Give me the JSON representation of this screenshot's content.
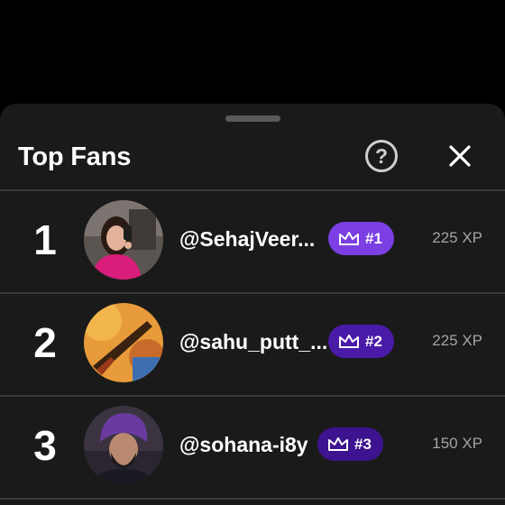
{
  "sheet": {
    "title": "Top Fans",
    "help_icon": "question-circle-icon",
    "help_glyph": "?",
    "close_icon": "close-x-icon"
  },
  "fans": [
    {
      "rank": "1",
      "username": "@SehajVeer...",
      "badge": "#1",
      "badge_color": "#7b3fe4",
      "xp": "225 XP",
      "avatar": "woman-pink-outfit-selfie-photo"
    },
    {
      "rank": "2",
      "username": "@sahu_putt_...",
      "badge": "#2",
      "badge_color": "#4a1aa8",
      "xp": "225 XP",
      "avatar": "orange-rifle-photo"
    },
    {
      "rank": "3",
      "username": "@sohana-i8y",
      "badge": "#3",
      "badge_color": "#3d138f",
      "xp": "150 XP",
      "avatar": "man-purple-turban-photo"
    }
  ],
  "colors": {
    "background": "#000000",
    "sheet": "#1a1a1a",
    "divider": "#3a3a3a",
    "text_primary": "#ffffff",
    "text_secondary": "#a4a4a4"
  }
}
